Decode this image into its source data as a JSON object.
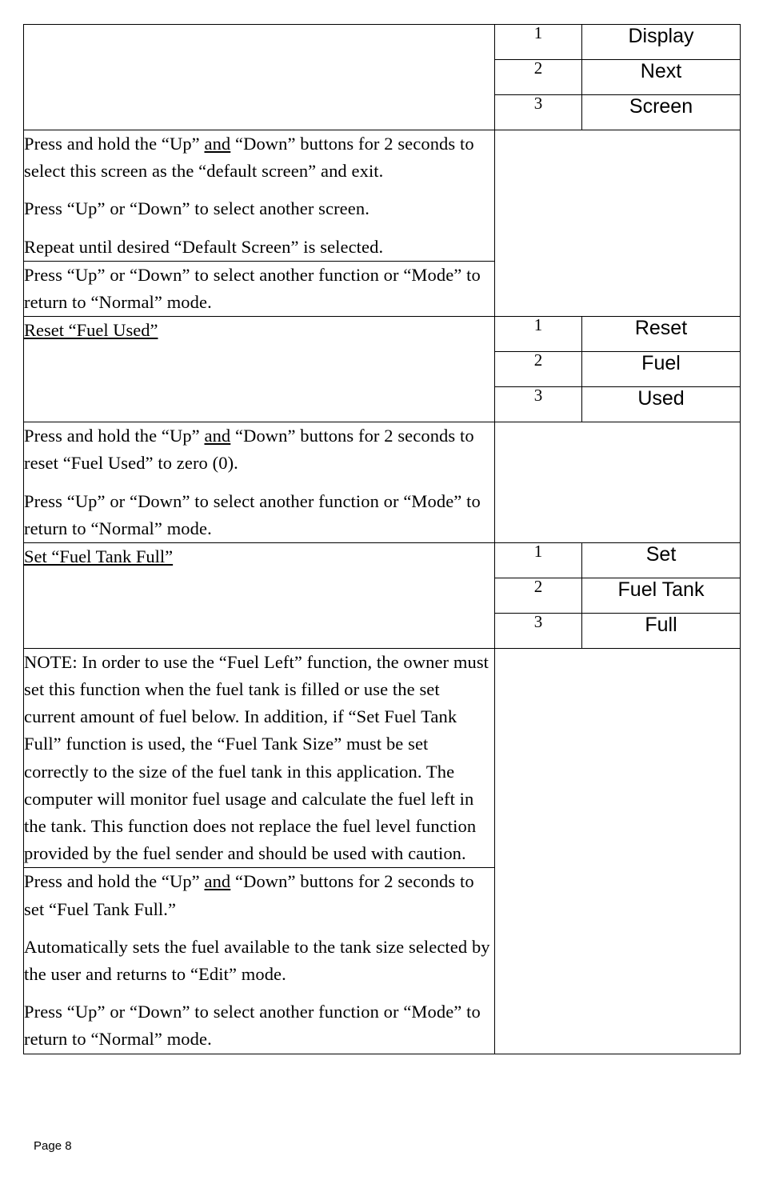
{
  "document": {
    "page_label": "Page 8",
    "colors": {
      "shaded_cell": "#969696",
      "border": "#000000",
      "text": "#000000",
      "background": "#ffffff"
    }
  },
  "sections": [
    {
      "id": "display-next-screen",
      "title": "",
      "steps": [
        {
          "number": "1",
          "label": "Display"
        },
        {
          "number": "2",
          "label": "Next"
        },
        {
          "number": "3",
          "label": "Screen"
        }
      ],
      "body_rows": [
        {
          "paragraphs": [
            {
              "runs": [
                {
                  "text": "Press and hold the “Up” ",
                  "underline": false
                },
                {
                  "text": "and",
                  "underline": true
                },
                {
                  "text": " “Down” buttons for 2 seconds to select this screen as the “default screen” and exit.",
                  "underline": false
                }
              ]
            },
            {
              "runs": [
                {
                  "text": "Press “Up” or “Down” to select another screen.",
                  "underline": false
                }
              ]
            },
            {
              "runs": [
                {
                  "text": "Repeat until desired “Default Screen” is selected.",
                  "underline": false
                }
              ]
            }
          ]
        },
        {
          "paragraphs": [
            {
              "runs": [
                {
                  "text": "Press “Up” or “Down” to select another function or “Mode” to return to “Normal” mode.",
                  "underline": false
                }
              ]
            }
          ]
        }
      ]
    },
    {
      "id": "reset-fuel-used",
      "title": "Reset “Fuel Used”",
      "steps": [
        {
          "number": "1",
          "label": "Reset"
        },
        {
          "number": "2",
          "label": "Fuel"
        },
        {
          "number": "3",
          "label": "Used"
        }
      ],
      "body_rows": [
        {
          "paragraphs": [
            {
              "runs": [
                {
                  "text": "Press and hold the “Up” ",
                  "underline": false
                },
                {
                  "text": "and",
                  "underline": true
                },
                {
                  "text": " “Down” buttons for 2 seconds to reset “Fuel Used” to zero (0).",
                  "underline": false
                }
              ]
            },
            {
              "runs": [
                {
                  "text": "Press “Up” or “Down” to select another function or “Mode” to return to “Normal” mode.",
                  "underline": false
                }
              ]
            }
          ]
        }
      ]
    },
    {
      "id": "set-fuel-tank-full",
      "title": "Set “Fuel Tank Full”",
      "steps": [
        {
          "number": "1",
          "label": "Set"
        },
        {
          "number": "2",
          "label": "Fuel Tank"
        },
        {
          "number": "3",
          "label": "Full"
        }
      ],
      "body_rows": [
        {
          "paragraphs": [
            {
              "runs": [
                {
                  "text": "NOTE: In order to use the “Fuel Left” function, the owner must set this function when the fuel tank is filled or use the set current amount of fuel below.  In addition, if “Set Fuel Tank Full” function is used, the “Fuel Tank Size” must be set correctly to the size of the fuel tank in this application.  The computer will monitor fuel usage and calculate the fuel left in the tank.  This function does not replace the fuel level function provided by the fuel sender and should be used with caution.",
                  "underline": false
                }
              ]
            }
          ]
        },
        {
          "paragraphs": [
            {
              "runs": [
                {
                  "text": "Press and hold the “Up” ",
                  "underline": false
                },
                {
                  "text": "and",
                  "underline": true
                },
                {
                  "text": " “Down” buttons for 2 seconds to set “Fuel Tank Full.”",
                  "underline": false
                }
              ]
            },
            {
              "runs": [
                {
                  "text": "Automatically sets the fuel available to the tank size selected by the user and returns to “Edit” mode.",
                  "underline": false
                }
              ]
            },
            {
              "runs": [
                {
                  "text": "Press “Up” or “Down” to select another function or “Mode” to return to “Normal” mode.",
                  "underline": false
                }
              ]
            }
          ]
        }
      ]
    }
  ]
}
